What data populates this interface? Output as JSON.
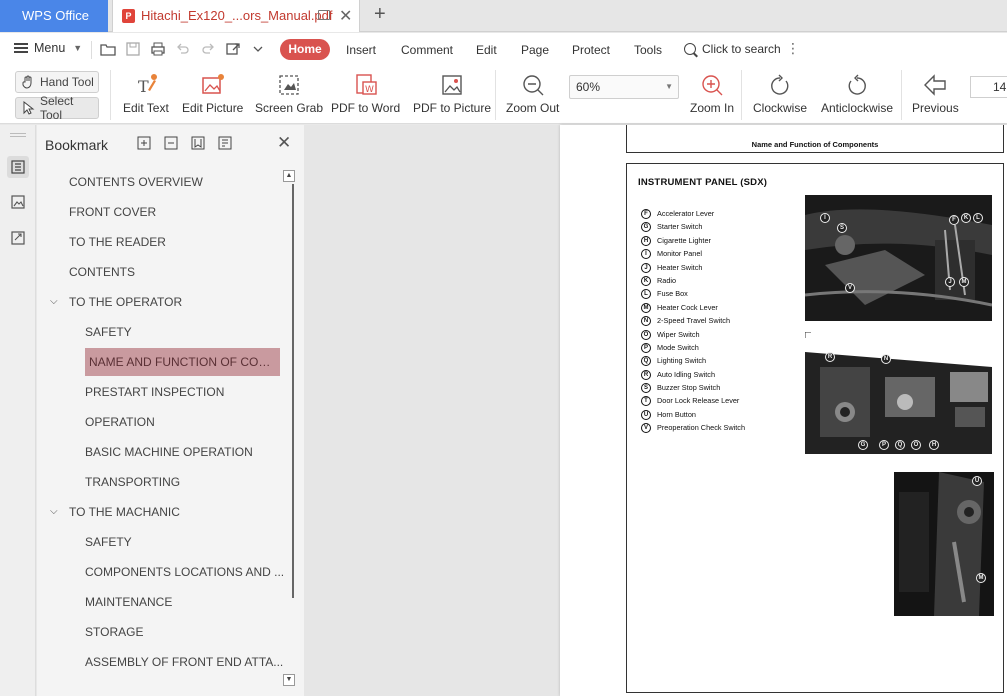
{
  "titlebar": {
    "app_tab": "WPS Office",
    "doc_tab": "Hitachi_Ex120_...ors_Manual.pdf"
  },
  "menubar": {
    "menu_label": "Menu",
    "items": [
      "Home",
      "Insert",
      "Comment",
      "Edit",
      "Page",
      "Protect",
      "Tools"
    ],
    "search_label": "Click to search",
    "accent": "#d9534f"
  },
  "toolbar": {
    "hand_tool": "Hand Tool",
    "select_tool": "Select Tool",
    "tools": [
      "Edit Text",
      "Edit Picture",
      "Screen Grab",
      "PDF to Word",
      "PDF to Picture",
      "Zoom Out",
      "Zoom In",
      "Clockwise",
      "Anticlockwise",
      "Previous"
    ],
    "zoom_value": "60%",
    "page_number": "14"
  },
  "bookmark": {
    "title": "Bookmark",
    "items": [
      {
        "label": "CONTENTS OVERVIEW",
        "level": 0
      },
      {
        "label": "FRONT COVER",
        "level": 0
      },
      {
        "label": "TO THE READER",
        "level": 0
      },
      {
        "label": "CONTENTS",
        "level": 0
      },
      {
        "label": "TO THE OPERATOR",
        "level": 0,
        "expanded": true
      },
      {
        "label": "SAFETY",
        "level": 1
      },
      {
        "label": "NAME AND FUNCTION OF COMP...",
        "level": 1,
        "selected": true
      },
      {
        "label": "PRESTART INSPECTION",
        "level": 1
      },
      {
        "label": "OPERATION",
        "level": 1
      },
      {
        "label": "BASIC MACHINE OPERATION",
        "level": 1
      },
      {
        "label": "TRANSPORTING",
        "level": 1
      },
      {
        "label": "TO THE MACHANIC",
        "level": 0,
        "expanded": true
      },
      {
        "label": "SAFETY",
        "level": 1
      },
      {
        "label": "COMPONENTS LOCATIONS AND ...",
        "level": 1
      },
      {
        "label": "MAINTENANCE",
        "level": 1
      },
      {
        "label": "STORAGE",
        "level": 1
      },
      {
        "label": "ASSEMBLY OF FRONT END ATTA...",
        "level": 1
      }
    ]
  },
  "document": {
    "page_header": "Name and Function of Components",
    "panel_title": "INSTRUMENT PANEL (SDX)",
    "legend": [
      {
        "key": "F",
        "label": "Accelerator Lever"
      },
      {
        "key": "G",
        "label": "Starter Switch"
      },
      {
        "key": "H",
        "label": "Cigarette Lighter"
      },
      {
        "key": "I",
        "label": "Monitor Panel"
      },
      {
        "key": "J",
        "label": "Heater Switch"
      },
      {
        "key": "K",
        "label": "Radio"
      },
      {
        "key": "L",
        "label": "Fuse Box"
      },
      {
        "key": "M",
        "label": "Heater Cock Lever"
      },
      {
        "key": "N",
        "label": "2-Speed Travel Switch"
      },
      {
        "key": "O",
        "label": "Wiper Switch"
      },
      {
        "key": "P",
        "label": "Mode Switch"
      },
      {
        "key": "Q",
        "label": "Lighting Switch"
      },
      {
        "key": "R",
        "label": "Auto Idling Switch"
      },
      {
        "key": "S",
        "label": "Buzzer Stop Switch"
      },
      {
        "key": "T",
        "label": "Door Lock Release Lever"
      },
      {
        "key": "U",
        "label": "Horn Button"
      },
      {
        "key": "V",
        "label": "Preoperation Check Switch"
      }
    ],
    "photo1_marks": [
      "I",
      "S",
      "F",
      "K",
      "L",
      "V",
      "J",
      "M"
    ],
    "photo2_marks": [
      "R",
      "N",
      "G",
      "P",
      "Q",
      "O",
      "H"
    ],
    "photo3_marks": [
      "U",
      "M"
    ]
  }
}
